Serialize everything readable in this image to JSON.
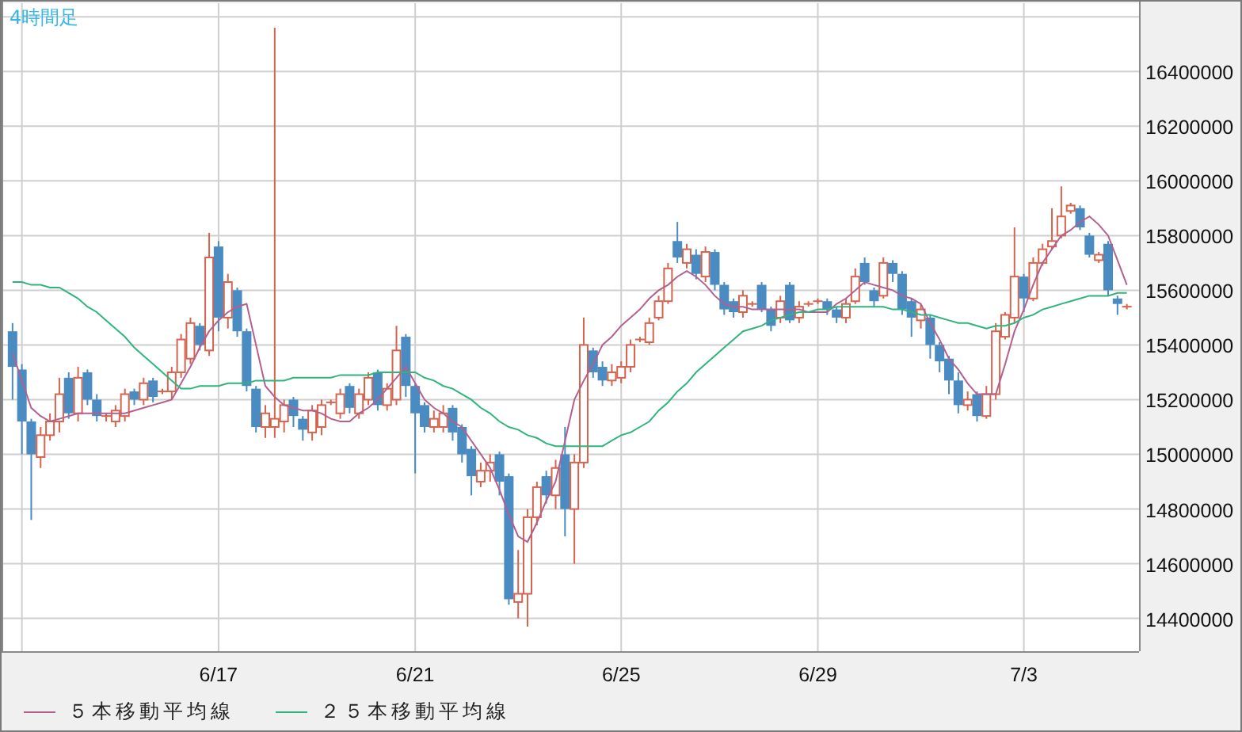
{
  "chart": {
    "chart_data": {
      "type": "candlestick",
      "title": "4時間足",
      "grid": true,
      "ylim": [
        14280000,
        16650000
      ],
      "categories": [
        null,
        null,
        null,
        null,
        null,
        null,
        null,
        null,
        null,
        null,
        null,
        null,
        null,
        null,
        null,
        null,
        null,
        null,
        null,
        null,
        null,
        null,
        "6/17",
        null,
        null,
        null,
        null,
        null,
        null,
        null,
        null,
        null,
        null,
        null,
        null,
        null,
        null,
        null,
        null,
        null,
        null,
        null,
        null,
        "6/21",
        null,
        null,
        null,
        null,
        null,
        null,
        null,
        null,
        null,
        null,
        null,
        null,
        null,
        null,
        null,
        null,
        null,
        null,
        null,
        null,
        null,
        "6/25",
        null,
        null,
        null,
        null,
        null,
        null,
        null,
        null,
        null,
        null,
        null,
        null,
        null,
        null,
        null,
        null,
        null,
        null,
        null,
        null,
        "6/29",
        null,
        null,
        null,
        null,
        null,
        null,
        null,
        null,
        null,
        null,
        null,
        null,
        null,
        null,
        null,
        null,
        null,
        null,
        null,
        null,
        null,
        "7/3",
        null,
        null,
        null,
        null,
        null,
        null,
        null,
        null,
        null,
        null,
        null
      ],
      "yticks": [
        14400000,
        14600000,
        14800000,
        15000000,
        15200000,
        15400000,
        15600000,
        15800000,
        16000000,
        16200000,
        16400000
      ],
      "series": [
        {
          "name": "５本移動平均線",
          "type": "line",
          "color": "#b4608e",
          "values": [
            15370000,
            15270000,
            15170000,
            15140000,
            15120000,
            15130000,
            15140000,
            15150000,
            15150000,
            15150000,
            15150000,
            15150000,
            15150000,
            15160000,
            15170000,
            15180000,
            15190000,
            15200000,
            15260000,
            15320000,
            15390000,
            15450000,
            15490000,
            15520000,
            15540000,
            15550000,
            15400000,
            15250000,
            15210000,
            15180000,
            15170000,
            15160000,
            15160000,
            15150000,
            15130000,
            15120000,
            15120000,
            15150000,
            15170000,
            15200000,
            15240000,
            15280000,
            15320000,
            15260000,
            15200000,
            15170000,
            15150000,
            15120000,
            15100000,
            15050000,
            15000000,
            14950000,
            14870000,
            14780000,
            14700000,
            14680000,
            14750000,
            14830000,
            14900000,
            15050000,
            15200000,
            15270000,
            15330000,
            15400000,
            15430000,
            15470000,
            15500000,
            15530000,
            15570000,
            15600000,
            15620000,
            15650000,
            15670000,
            15650000,
            15620000,
            15580000,
            15550000,
            15540000,
            15540000,
            15530000,
            15530000,
            15530000,
            15530000,
            15530000,
            15530000,
            15520000,
            15520000,
            15520000,
            15550000,
            15570000,
            15600000,
            15630000,
            15620000,
            15610000,
            15600000,
            15580000,
            15570000,
            15550000,
            15480000,
            15420000,
            15350000,
            15310000,
            15260000,
            15220000,
            15220000,
            15220000,
            15330000,
            15450000,
            15530000,
            15620000,
            15700000,
            15750000,
            15800000,
            15820000,
            15850000,
            15870000,
            15840000,
            15800000,
            15710000,
            15620000
          ]
        },
        {
          "name": "２５本移動平均線",
          "type": "line",
          "color": "#2fb57c",
          "values": [
            15630000,
            15630000,
            15620000,
            15620000,
            15610000,
            15610000,
            15590000,
            15570000,
            15540000,
            15520000,
            15490000,
            15460000,
            15430000,
            15390000,
            15360000,
            15330000,
            15300000,
            15270000,
            15240000,
            15240000,
            15250000,
            15250000,
            15250000,
            15260000,
            15260000,
            15260000,
            15270000,
            15270000,
            15270000,
            15270000,
            15280000,
            15280000,
            15280000,
            15280000,
            15280000,
            15290000,
            15290000,
            15290000,
            15290000,
            15300000,
            15300000,
            15300000,
            15300000,
            15300000,
            15280000,
            15270000,
            15250000,
            15240000,
            15220000,
            15200000,
            15170000,
            15150000,
            15120000,
            15100000,
            15090000,
            15070000,
            15060000,
            15040000,
            15030000,
            15030000,
            15030000,
            15030000,
            15030000,
            15030000,
            15050000,
            15070000,
            15080000,
            15100000,
            15120000,
            15160000,
            15190000,
            15230000,
            15260000,
            15300000,
            15330000,
            15360000,
            15390000,
            15420000,
            15450000,
            15460000,
            15470000,
            15490000,
            15500000,
            15510000,
            15520000,
            15520000,
            15530000,
            15530000,
            15540000,
            15540000,
            15540000,
            15540000,
            15540000,
            15540000,
            15530000,
            15530000,
            15520000,
            15510000,
            15510000,
            15500000,
            15490000,
            15480000,
            15480000,
            15470000,
            15460000,
            15470000,
            15470000,
            15480000,
            15500000,
            15510000,
            15530000,
            15540000,
            15550000,
            15560000,
            15570000,
            15580000,
            15580000,
            15580000,
            15590000,
            15590000
          ]
        }
      ],
      "ohlc": [
        [
          15450000,
          15480000,
          15200000,
          15320000
        ],
        [
          15310000,
          15330000,
          15000000,
          15120000
        ],
        [
          15120000,
          15130000,
          14760000,
          15000000
        ],
        [
          14990000,
          15100000,
          14950000,
          15070000
        ],
        [
          15070000,
          15150000,
          15050000,
          15120000
        ],
        [
          15120000,
          15280000,
          15080000,
          15220000
        ],
        [
          15280000,
          15300000,
          15130000,
          15150000
        ],
        [
          15150000,
          15320000,
          15120000,
          15280000
        ],
        [
          15300000,
          15310000,
          15180000,
          15200000
        ],
        [
          15200000,
          15220000,
          15120000,
          15140000
        ],
        [
          15140000,
          15150000,
          15120000,
          15140000
        ],
        [
          15120000,
          15180000,
          15100000,
          15160000
        ],
        [
          15140000,
          15240000,
          15120000,
          15220000
        ],
        [
          15230000,
          15240000,
          15180000,
          15200000
        ],
        [
          15200000,
          15280000,
          15180000,
          15260000
        ],
        [
          15270000,
          15280000,
          15190000,
          15210000
        ],
        [
          15230000,
          15240000,
          15220000,
          15230000
        ],
        [
          15230000,
          15320000,
          15200000,
          15300000
        ],
        [
          15300000,
          15440000,
          15280000,
          15420000
        ],
        [
          15350000,
          15500000,
          15330000,
          15480000
        ],
        [
          15470000,
          15480000,
          15380000,
          15400000
        ],
        [
          15380000,
          15810000,
          15360000,
          15720000
        ],
        [
          15760000,
          15780000,
          15450000,
          15500000
        ],
        [
          15500000,
          15660000,
          15460000,
          15630000
        ],
        [
          15600000,
          15610000,
          15430000,
          15450000
        ],
        [
          15450000,
          15460000,
          15230000,
          15250000
        ],
        [
          15240000,
          15250000,
          15080000,
          15100000
        ],
        [
          15100000,
          15180000,
          15060000,
          15150000
        ],
        [
          15100000,
          16560000,
          15060000,
          15130000
        ],
        [
          15120000,
          15200000,
          15080000,
          15180000
        ],
        [
          15200000,
          15210000,
          15100000,
          15140000
        ],
        [
          15130000,
          15140000,
          15050000,
          15090000
        ],
        [
          15080000,
          15180000,
          15050000,
          15160000
        ],
        [
          15100000,
          15200000,
          15070000,
          15180000
        ],
        [
          15190000,
          15200000,
          15180000,
          15190000
        ],
        [
          15150000,
          15240000,
          15130000,
          15220000
        ],
        [
          15250000,
          15260000,
          15150000,
          15170000
        ],
        [
          15150000,
          15240000,
          15130000,
          15220000
        ],
        [
          15200000,
          15300000,
          15180000,
          15280000
        ],
        [
          15300000,
          15310000,
          15160000,
          15180000
        ],
        [
          15180000,
          15260000,
          15160000,
          15240000
        ],
        [
          15200000,
          15470000,
          15180000,
          15380000
        ],
        [
          15430000,
          15440000,
          15210000,
          15250000
        ],
        [
          15250000,
          15260000,
          14930000,
          15150000
        ],
        [
          15180000,
          15190000,
          15080000,
          15100000
        ],
        [
          15100000,
          15160000,
          15080000,
          15130000
        ],
        [
          15100000,
          15180000,
          15080000,
          15150000
        ],
        [
          15170000,
          15180000,
          15050000,
          15080000
        ],
        [
          15100000,
          15110000,
          14970000,
          15000000
        ],
        [
          15020000,
          15030000,
          14850000,
          14920000
        ],
        [
          14900000,
          14970000,
          14880000,
          14940000
        ],
        [
          14940000,
          15000000,
          14900000,
          14970000
        ],
        [
          15000000,
          15010000,
          14850000,
          14900000
        ],
        [
          14920000,
          14930000,
          14450000,
          14470000
        ],
        [
          14460000,
          14650000,
          14400000,
          14490000
        ],
        [
          14490000,
          14800000,
          14370000,
          14770000
        ],
        [
          14770000,
          14900000,
          14740000,
          14880000
        ],
        [
          14920000,
          14940000,
          14820000,
          14850000
        ],
        [
          14850000,
          14980000,
          14800000,
          14950000
        ],
        [
          15000000,
          15100000,
          14700000,
          14800000
        ],
        [
          14800000,
          15000000,
          14600000,
          14970000
        ],
        [
          14970000,
          15500000,
          14950000,
          15400000
        ],
        [
          15380000,
          15390000,
          15280000,
          15300000
        ],
        [
          15320000,
          15340000,
          15250000,
          15270000
        ],
        [
          15270000,
          15330000,
          15250000,
          15300000
        ],
        [
          15280000,
          15340000,
          15260000,
          15320000
        ],
        [
          15320000,
          15420000,
          15300000,
          15400000
        ],
        [
          15420000,
          15430000,
          15410000,
          15420000
        ],
        [
          15410000,
          15500000,
          15400000,
          15480000
        ],
        [
          15500000,
          15580000,
          15490000,
          15560000
        ],
        [
          15560000,
          15700000,
          15550000,
          15680000
        ],
        [
          15780000,
          15850000,
          15700000,
          15720000
        ],
        [
          15700000,
          15770000,
          15680000,
          15750000
        ],
        [
          15730000,
          15750000,
          15640000,
          15660000
        ],
        [
          15650000,
          15760000,
          15630000,
          15740000
        ],
        [
          15740000,
          15750000,
          15600000,
          15620000
        ],
        [
          15620000,
          15630000,
          15510000,
          15530000
        ],
        [
          15560000,
          15570000,
          15500000,
          15520000
        ],
        [
          15520000,
          15600000,
          15500000,
          15580000
        ],
        [
          15550000,
          15560000,
          15540000,
          15550000
        ],
        [
          15620000,
          15630000,
          15520000,
          15530000
        ],
        [
          15530000,
          15540000,
          15450000,
          15470000
        ],
        [
          15500000,
          15580000,
          15480000,
          15560000
        ],
        [
          15620000,
          15630000,
          15480000,
          15490000
        ],
        [
          15500000,
          15560000,
          15480000,
          15540000
        ],
        [
          15550000,
          15560000,
          15540000,
          15550000
        ],
        [
          15560000,
          15570000,
          15550000,
          15560000
        ],
        [
          15560000,
          15570000,
          15510000,
          15530000
        ],
        [
          15530000,
          15540000,
          15480000,
          15500000
        ],
        [
          15500000,
          15570000,
          15480000,
          15550000
        ],
        [
          15560000,
          15680000,
          15550000,
          15650000
        ],
        [
          15700000,
          15720000,
          15620000,
          15630000
        ],
        [
          15600000,
          15610000,
          15540000,
          15560000
        ],
        [
          15580000,
          15720000,
          15570000,
          15700000
        ],
        [
          15700000,
          15710000,
          15630000,
          15660000
        ],
        [
          15660000,
          15670000,
          15510000,
          15530000
        ],
        [
          15560000,
          15570000,
          15430000,
          15500000
        ],
        [
          15490000,
          15550000,
          15460000,
          15530000
        ],
        [
          15500000,
          15510000,
          15350000,
          15400000
        ],
        [
          15400000,
          15410000,
          15300000,
          15340000
        ],
        [
          15350000,
          15360000,
          15220000,
          15270000
        ],
        [
          15270000,
          15300000,
          15150000,
          15180000
        ],
        [
          15180000,
          15230000,
          15160000,
          15200000
        ],
        [
          15220000,
          15230000,
          15120000,
          15140000
        ],
        [
          15140000,
          15250000,
          15130000,
          15220000
        ],
        [
          15220000,
          15480000,
          15200000,
          15450000
        ],
        [
          15430000,
          15520000,
          15420000,
          15510000
        ],
        [
          15500000,
          15830000,
          15480000,
          15650000
        ],
        [
          15650000,
          15660000,
          15520000,
          15570000
        ],
        [
          15570000,
          15720000,
          15560000,
          15700000
        ],
        [
          15700000,
          15770000,
          15690000,
          15750000
        ],
        [
          15760000,
          15900000,
          15750000,
          15780000
        ],
        [
          15800000,
          15980000,
          15790000,
          15870000
        ],
        [
          15890000,
          15920000,
          15880000,
          15910000
        ],
        [
          15900000,
          15910000,
          15820000,
          15830000
        ],
        [
          15800000,
          15810000,
          15720000,
          15730000
        ],
        [
          15710000,
          15740000,
          15700000,
          15730000
        ],
        [
          15770000,
          15780000,
          15580000,
          15600000
        ],
        [
          15570000,
          15580000,
          15510000,
          15550000
        ],
        [
          15540000,
          15550000,
          15530000,
          15540000
        ]
      ]
    }
  }
}
